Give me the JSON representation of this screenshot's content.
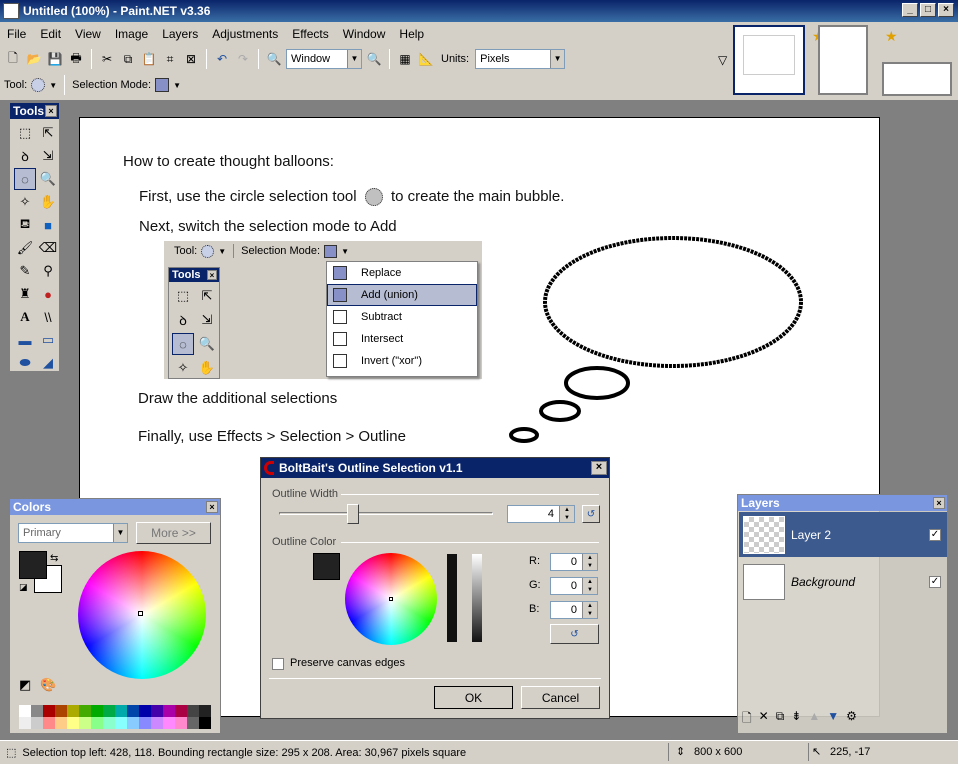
{
  "window": {
    "title": "Untitled (100%) - Paint.NET v3.36"
  },
  "menu": [
    "File",
    "Edit",
    "View",
    "Image",
    "Layers",
    "Adjustments",
    "Effects",
    "Window",
    "Help"
  ],
  "toolbar": {
    "zoom_value": "Window",
    "units_label": "Units:",
    "units_value": "Pixels"
  },
  "toolbar2": {
    "tool_label": "Tool:",
    "selection_mode_label": "Selection Mode:"
  },
  "tools_panel": {
    "title": "Tools"
  },
  "canvas": {
    "heading": "How to create thought balloons:",
    "step1a": "First, use the circle selection tool",
    "step1b": "to create the main bubble.",
    "step2": "Next, switch the selection mode to Add",
    "step3": "Draw the additional selections",
    "step4": "Finally, use Effects > Selection > Outline",
    "inset": {
      "tool_label": "Tool:",
      "selection_mode_label": "Selection Mode:",
      "tools_title": "Tools",
      "menu_items": [
        "Replace",
        "Add (union)",
        "Subtract",
        "Intersect",
        "Invert (\"xor\")"
      ]
    }
  },
  "colors_panel": {
    "title": "Colors",
    "mode": "Primary",
    "more_button": "More >>",
    "primary_color": "#222222",
    "secondary_color": "#ffffff"
  },
  "outline_dialog": {
    "title": "BoltBait's Outline Selection v1.1",
    "width_label": "Outline Width",
    "width_value": "4",
    "color_label": "Outline Color",
    "r_label": "R:",
    "r_value": "0",
    "g_label": "G:",
    "g_value": "0",
    "b_label": "B:",
    "b_value": "0",
    "preserve_label": "Preserve canvas edges",
    "ok": "OK",
    "cancel": "Cancel"
  },
  "layers_panel": {
    "title": "Layers",
    "layers": [
      "Layer 2",
      "Background"
    ]
  },
  "status": {
    "selection": "Selection top left: 428, 118. Bounding rectangle size: 295 x 208. Area: 30,967 pixels square",
    "image_size": "800 x 600",
    "cursor": "225, -17"
  }
}
